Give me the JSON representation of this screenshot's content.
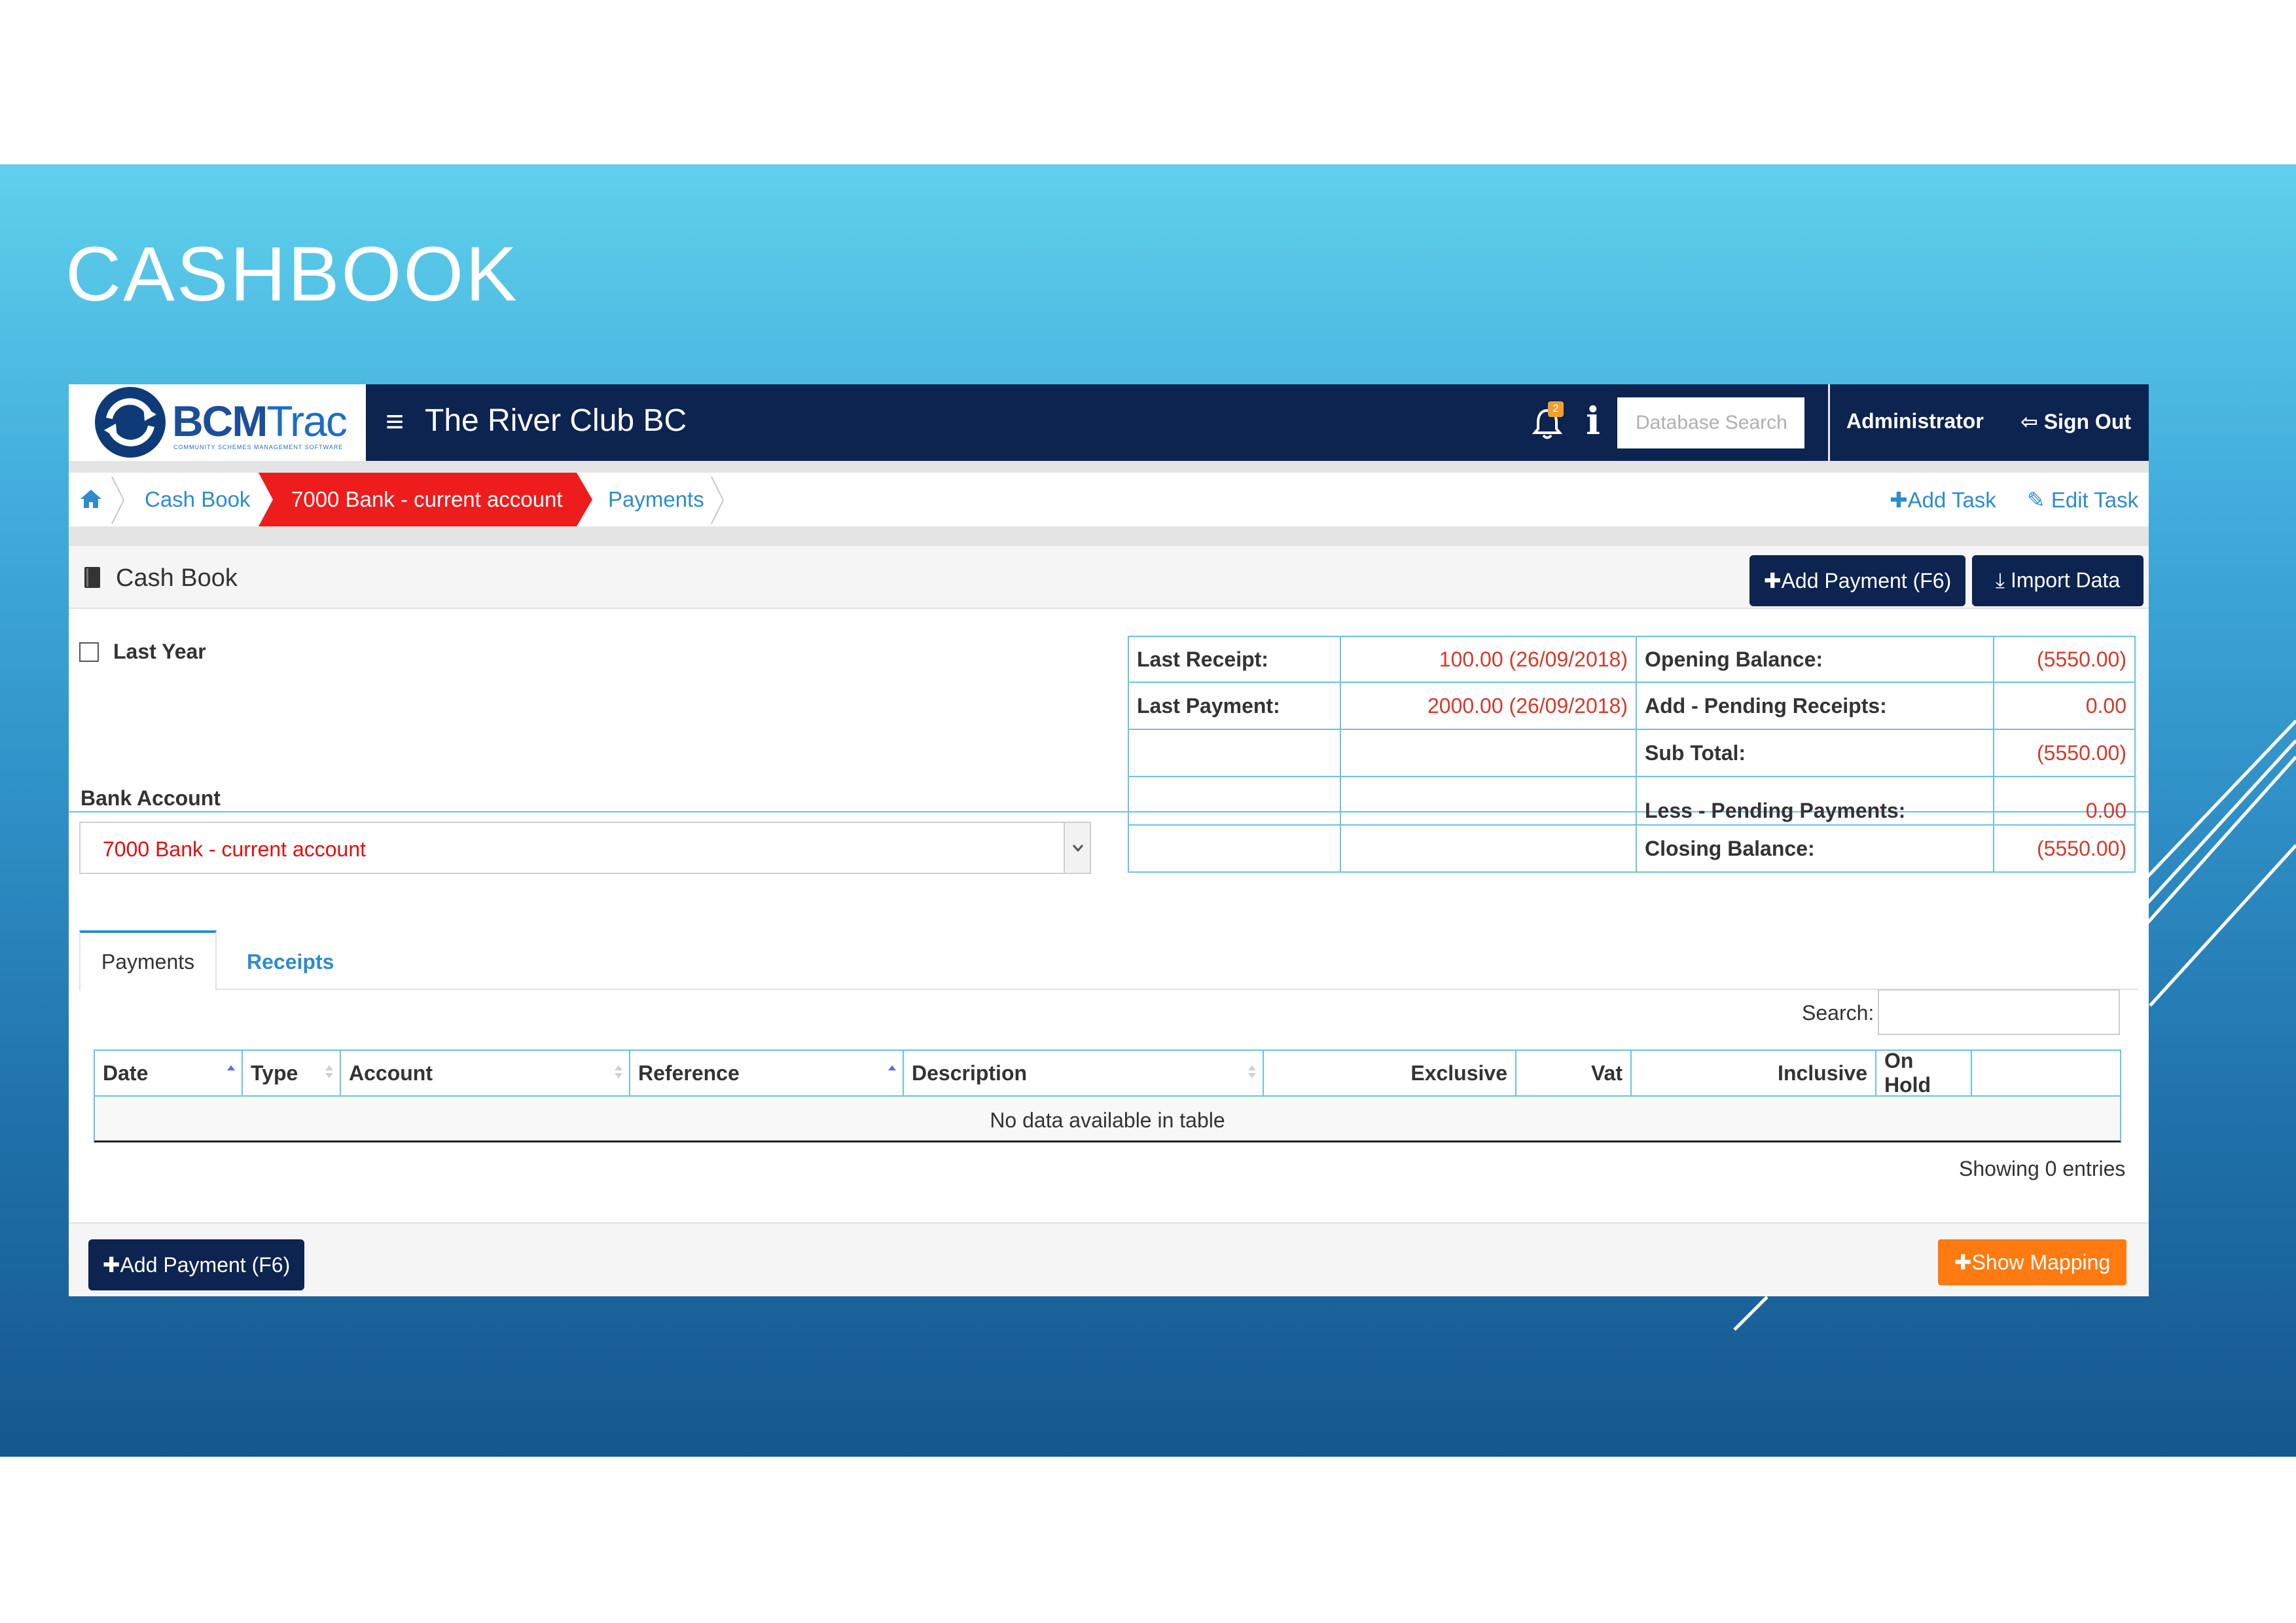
{
  "slide": {
    "title": "CASHBOOK"
  },
  "navbar": {
    "logo_bcm": "BCM",
    "logo_trac": "Trac",
    "logo_tagline": "COMMUNITY SCHEMES MANAGEMENT SOFTWARE",
    "menu_icon": "≡",
    "app_name": "The River Club BC",
    "notification_count": "2",
    "info_icon": "i",
    "search_placeholder": "Database Search",
    "user": "Administrator",
    "signout_label": "Sign Out"
  },
  "breadcrumb": {
    "items": [
      "Cash Book",
      "7000 Bank - current account",
      "Payments"
    ],
    "add_task": "Add Task",
    "edit_task": "Edit Task"
  },
  "panel": {
    "title": "Cash Book",
    "add_payment": "Add Payment (F6)",
    "import_data": "Import Data"
  },
  "form": {
    "last_year_label": "Last Year",
    "last_year_checked": false,
    "bank_account_label": "Bank Account",
    "bank_account_value": "7000 Bank - current account"
  },
  "summary": {
    "rows": [
      {
        "left_label": "Last Receipt:",
        "left_value": "100.00 (26/09/2018)",
        "right_label": "Opening Balance:",
        "right_value": "(5550.00)"
      },
      {
        "left_label": "Last Payment:",
        "left_value": "2000.00 (26/09/2018)",
        "right_label": "Add - Pending Receipts:",
        "right_value": "0.00"
      },
      {
        "left_label": "",
        "left_value": "",
        "right_label": "Sub Total:",
        "right_value": "(5550.00)"
      },
      {
        "left_label": "",
        "left_value": "",
        "right_label": "Less - Pending Payments:",
        "right_value": "0.00"
      },
      {
        "left_label": "",
        "left_value": "",
        "right_label": "Closing Balance:",
        "right_value": "(5550.00)"
      }
    ]
  },
  "tabs": [
    "Payments",
    "Receipts"
  ],
  "table": {
    "search_label": "Search:",
    "columns": [
      "Date",
      "Type",
      "Account",
      "Reference",
      "Description",
      "Exclusive",
      "Vat",
      "Inclusive",
      "On Hold",
      ""
    ],
    "empty_message": "No data available in table",
    "showing": "Showing 0 entries"
  },
  "footer": {
    "add_payment": "Add Payment (F6)",
    "show_mapping": "Show Mapping"
  },
  "colors": {
    "navbar": "#0d2350",
    "breadcrumb_active": "#ee1c1c",
    "link": "#2e8ccc",
    "negative_value": "#d43a2a",
    "mapping_button": "#ff7a10"
  }
}
